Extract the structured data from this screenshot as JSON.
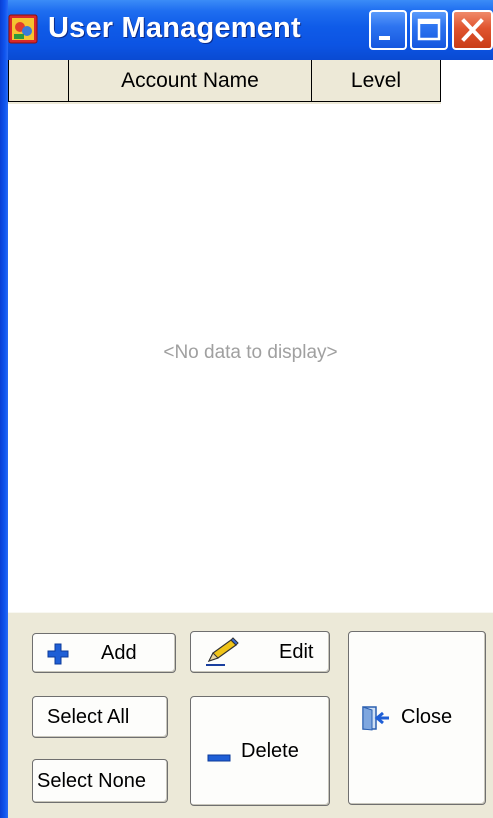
{
  "window": {
    "title": "User Management",
    "icons": {
      "app": "user-management-app-icon",
      "minimize": "minimize-icon",
      "maximize": "maximize-icon",
      "close": "close-x-icon"
    }
  },
  "grid": {
    "columns": [
      "",
      "Account Name",
      "Level"
    ],
    "rows": [],
    "empty_text": "<No data to display>"
  },
  "buttons": {
    "add": {
      "label": "Add",
      "icon": "plus-icon"
    },
    "edit": {
      "label": "Edit",
      "icon": "pencil-icon"
    },
    "close": {
      "label": "Close",
      "icon": "exit-door-icon"
    },
    "select_all": {
      "label": "Select All"
    },
    "delete": {
      "label": "Delete",
      "icon": "minus-icon"
    },
    "select_none": {
      "label": "Select None"
    }
  },
  "colors": {
    "titlebar": "#0c54e3",
    "close_button": "#e0542f",
    "header_bg": "#ede9d7",
    "footer_bg": "#ece9d8",
    "empty_text": "#a0a0a0",
    "accent_blue": "#1a5fd0"
  }
}
